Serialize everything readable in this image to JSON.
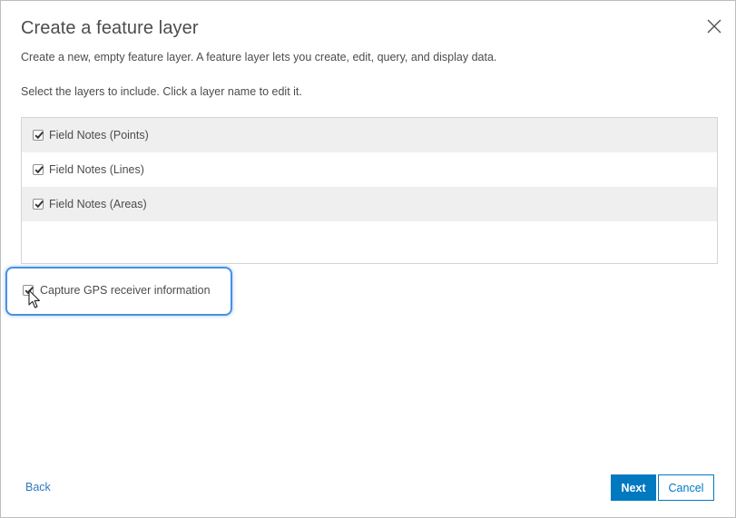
{
  "dialog": {
    "title": "Create a feature layer",
    "description": "Create a new, empty feature layer. A feature layer lets you create, edit, query, and display data.",
    "instruction": "Select the layers to include. Click a layer name to edit it."
  },
  "layers": [
    {
      "label": "Field Notes (Points)",
      "checked": true
    },
    {
      "label": "Field Notes (Lines)",
      "checked": true
    },
    {
      "label": "Field Notes (Areas)",
      "checked": true
    }
  ],
  "gps_option": {
    "label": "Capture GPS receiver information",
    "checked": true
  },
  "footer": {
    "back_label": "Back",
    "next_label": "Next",
    "cancel_label": "Cancel"
  },
  "icons": {
    "close": "close-icon",
    "check": "checkmark-icon",
    "cursor": "mouse-pointer-icon"
  },
  "colors": {
    "accent": "#0079c1",
    "highlight": "#4a90e2",
    "text": "#4c4c4c",
    "row_shade": "#efefef"
  }
}
